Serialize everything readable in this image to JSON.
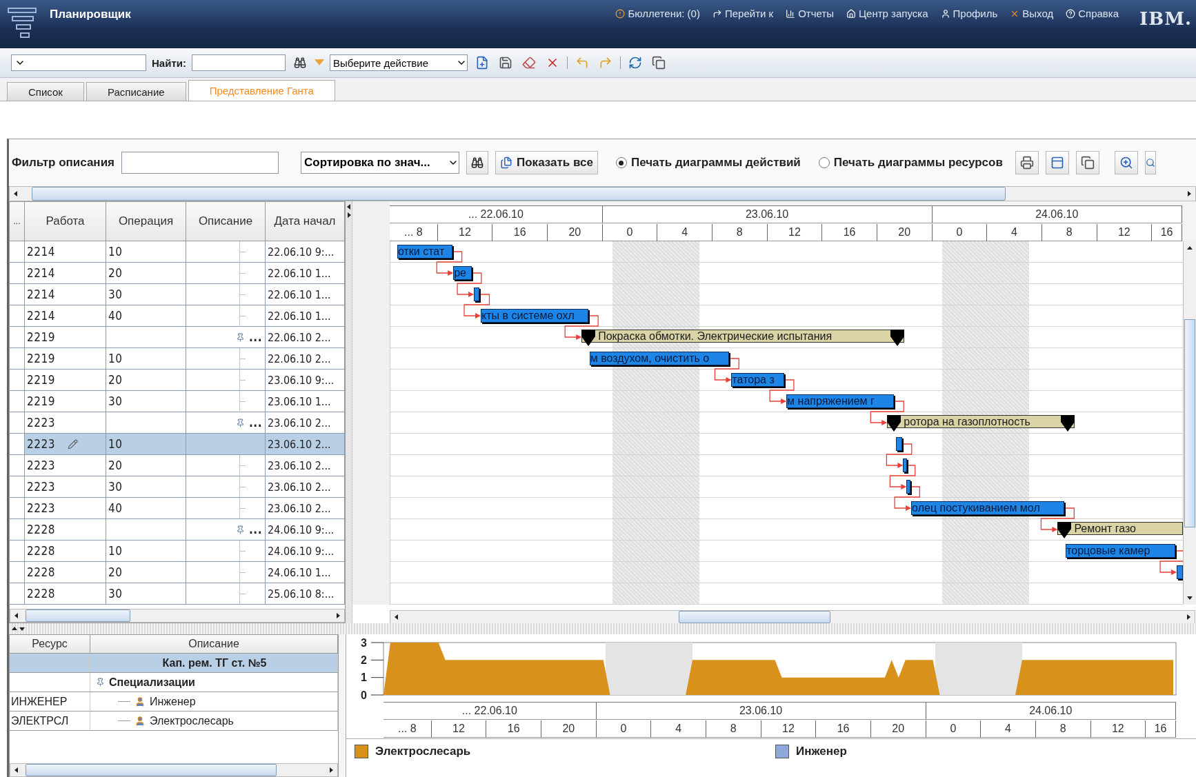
{
  "header": {
    "title": "Планировщик",
    "links": [
      "Бюллетени: (0)",
      "Перейти к",
      "Отчеты",
      "Центр запуска",
      "Профиль",
      "Выход",
      "Справка"
    ],
    "logo": "IBM."
  },
  "toolbar": {
    "find_label": "Найти:",
    "action_select": "Выберите действие"
  },
  "tabs": [
    {
      "label": "Список",
      "selected": false
    },
    {
      "label": "Расписание",
      "selected": false
    },
    {
      "label": "Представление Ганта",
      "selected": true
    }
  ],
  "filter": {
    "label": "Фильтр описания",
    "sort_select": "Сортировка по знач...",
    "show_all": "Показать все",
    "print_options": [
      {
        "label": "Печать диаграммы действий",
        "selected": true
      },
      {
        "label": "Печать диаграммы ресурсов",
        "selected": false
      }
    ]
  },
  "table": {
    "columns": [
      "...",
      "Работа",
      "Операция",
      "Описание",
      "Дата начал"
    ],
    "rows": [
      {
        "kind": "child",
        "job": "2214",
        "operation": "10",
        "start": "22.06.10 9:...",
        "selected": false
      },
      {
        "kind": "child",
        "job": "2214",
        "operation": "20",
        "start": "22.06.10 1...",
        "selected": false
      },
      {
        "kind": "child",
        "job": "2214",
        "operation": "30",
        "start": "22.06.10 1...",
        "selected": false
      },
      {
        "kind": "child",
        "job": "2214",
        "operation": "40",
        "start": "22.06.10 1...",
        "selected": false
      },
      {
        "kind": "group",
        "job": "2219",
        "description": "...",
        "start": "22.06.10 2...",
        "selected": false
      },
      {
        "kind": "child",
        "job": "2219",
        "operation": "10",
        "start": "22.06.10 2...",
        "selected": false
      },
      {
        "kind": "child",
        "job": "2219",
        "operation": "20",
        "start": "23.06.10 9:...",
        "selected": false
      },
      {
        "kind": "child",
        "job": "2219",
        "operation": "30",
        "start": "23.06.10 1...",
        "selected": false
      },
      {
        "kind": "group",
        "job": "2223",
        "description": "...",
        "start": "23.06.10 2...",
        "selected": false
      },
      {
        "kind": "child",
        "job": "2223",
        "operation": "10",
        "start": "23.06.10 2...",
        "selected": true
      },
      {
        "kind": "child",
        "job": "2223",
        "operation": "20",
        "start": "23.06.10 2...",
        "selected": false
      },
      {
        "kind": "child",
        "job": "2223",
        "operation": "30",
        "start": "23.06.10 2...",
        "selected": false
      },
      {
        "kind": "child",
        "job": "2223",
        "operation": "40",
        "start": "23.06.10 2...",
        "selected": false
      },
      {
        "kind": "group",
        "job": "2228",
        "description": "...",
        "start": "24.06.10 9:...",
        "selected": false
      },
      {
        "kind": "child",
        "job": "2228",
        "operation": "10",
        "start": "24.06.10 9:...",
        "selected": false
      },
      {
        "kind": "child",
        "job": "2228",
        "operation": "20",
        "start": "24.06.10 1...",
        "selected": false
      },
      {
        "kind": "child",
        "job": "2228",
        "operation": "30",
        "start": "25.06.10 8:...",
        "selected": false
      }
    ]
  },
  "gantt": {
    "timescale": {
      "days": [
        "... 22.06.10",
        "23.06.10",
        "24.06.10"
      ],
      "hours": [
        "... 8",
        "12",
        "16",
        "20",
        "0",
        "4",
        "8",
        "12",
        "16",
        "20",
        "0",
        "4",
        "8",
        "12",
        "16"
      ]
    },
    "rows": [
      {
        "kind": "task",
        "label": "отки стат",
        "linked": false
      },
      {
        "kind": "task",
        "label": "ре",
        "linked": true
      },
      {
        "kind": "task",
        "linked": true
      },
      {
        "kind": "task",
        "label": "кты в системе охл",
        "linked": true
      },
      {
        "kind": "summary",
        "label": "Покраска обмотки. Электрические испытания",
        "linked": true
      },
      {
        "kind": "task",
        "label": "м воздухом, очистить о",
        "linked": false
      },
      {
        "kind": "task",
        "label": "татора з",
        "linked": true
      },
      {
        "kind": "task",
        "label": "м напряжением г",
        "linked": true
      },
      {
        "kind": "summary",
        "label": "ротора на газоплотность",
        "linked": true
      },
      {
        "kind": "task",
        "linked": false
      },
      {
        "kind": "task",
        "linked": true
      },
      {
        "kind": "task",
        "linked": true
      },
      {
        "kind": "task",
        "label": "олец постукиванием мол",
        "linked": true
      },
      {
        "kind": "summary",
        "label": "Ремонт газо",
        "linked": true
      },
      {
        "kind": "task",
        "label": "торцовые камер",
        "linked": false
      },
      {
        "kind": "task",
        "linked": true
      },
      {
        "kind": "none"
      }
    ]
  },
  "resources": {
    "columns": [
      "Ресурс",
      "Описание"
    ],
    "rows": [
      {
        "kind": "group",
        "description": "Кап. рем. ТГ ст. №5",
        "selected": true
      },
      {
        "kind": "folder",
        "description": "Специализации",
        "selected": false
      },
      {
        "kind": "person",
        "resource": "ИНЖЕНЕР",
        "description": "Инженер",
        "selected": false
      },
      {
        "kind": "person",
        "resource": "ЭЛЕКТРСЛ",
        "description": "Электрослесарь",
        "selected": false
      }
    ]
  },
  "resource_chart": {
    "timescale": {
      "days": [
        "... 22.06.10",
        "23.06.10",
        "24.06.10"
      ],
      "hours": [
        "... 8",
        "12",
        "16",
        "20",
        "0",
        "4",
        "8",
        "12",
        "16",
        "20",
        "0",
        "4",
        "8",
        "12",
        "16"
      ]
    },
    "chart_data": {
      "type": "area",
      "categories": [
        null,
        null,
        null,
        null,
        null,
        null,
        null,
        null,
        null,
        null,
        null,
        null,
        null,
        null,
        null,
        null,
        null,
        null,
        null,
        null,
        null,
        null,
        null,
        null,
        null,
        null,
        null,
        null,
        null,
        null,
        null,
        null,
        null,
        null,
        null,
        null,
        null,
        null,
        null,
        null,
        null,
        null,
        null,
        null,
        null,
        null,
        null,
        null,
        null,
        null,
        null,
        null,
        null,
        null,
        null,
        null,
        null,
        null,
        null,
        null,
        null,
        null,
        null,
        null,
        null,
        null,
        null,
        null,
        null,
        null,
        null,
        null,
        null,
        null,
        null,
        null,
        null,
        null,
        null,
        null,
        null,
        null,
        null,
        null,
        null,
        null,
        null,
        null,
        null,
        null,
        null,
        null,
        null,
        null,
        null,
        null,
        null,
        null,
        null,
        null,
        null,
        null,
        null,
        null,
        null,
        null,
        null,
        null,
        null,
        null,
        null,
        null,
        null,
        null,
        null,
        null
      ],
      "ylim": [
        0,
        3
      ],
      "yticks": [
        0,
        1,
        2,
        3
      ],
      "series": [
        {
          "color": "#d8921c",
          "values": [
            0,
            3,
            3,
            3,
            3,
            3,
            3,
            3,
            3,
            2,
            2,
            2,
            2,
            2,
            2,
            2,
            2,
            2,
            2,
            2,
            2,
            2,
            2,
            2,
            2,
            2,
            2,
            2,
            2,
            2,
            2,
            2,
            2,
            0,
            0,
            0,
            0,
            0,
            0,
            0,
            0,
            0,
            0,
            0,
            0,
            2,
            2,
            2,
            2,
            2,
            2,
            2,
            2,
            2,
            2,
            2,
            2,
            2,
            1,
            1,
            1,
            1,
            1,
            1,
            1,
            1,
            1,
            1,
            1,
            1,
            1,
            1,
            1,
            1,
            2,
            1,
            2,
            2,
            2,
            2,
            2,
            0,
            0,
            0,
            0,
            0,
            0,
            0,
            0,
            0,
            0,
            0,
            0,
            2,
            2,
            2,
            2,
            2,
            2,
            2,
            2,
            2,
            2,
            2,
            2,
            2,
            2,
            2,
            2,
            2,
            2,
            2,
            2,
            2,
            2,
            2
          ]
        }
      ]
    },
    "legend": [
      {
        "label": "Электрослесарь",
        "color": "#d8921c"
      },
      {
        "label": "Инженер",
        "color": "#8fa8dc"
      }
    ]
  }
}
